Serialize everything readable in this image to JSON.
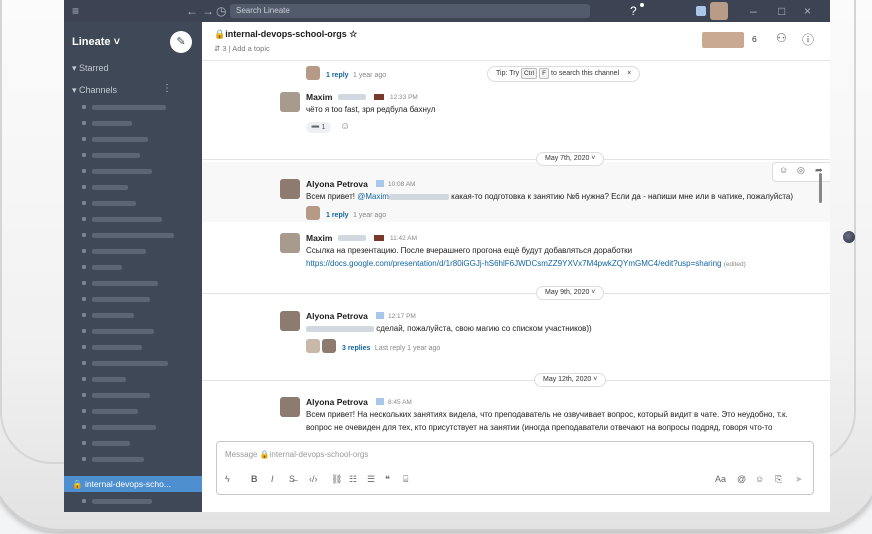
{
  "titlebar": {
    "search_placeholder": "Search Lineate"
  },
  "sidebar": {
    "workspace": "Lineate ˅",
    "compose_icon": "edit-icon",
    "starred_label": "▾  Starred",
    "channels_label": "▾  Channels",
    "active_channel": "🔒  internal-devops-scho..."
  },
  "channel": {
    "title": "🔒internal-devops-school-orgs ☆",
    "meta": "⇵ 3  |  Add a topic",
    "member_count": "6"
  },
  "tip": {
    "prefix": "Tip: Try",
    "key1": "Ctrl",
    "key2": "F",
    "suffix": "to search this channel",
    "close": "×"
  },
  "messages": {
    "m0": {
      "reply": "1 reply",
      "reply_meta": "1 year ago"
    },
    "m1": {
      "name": "Maxim",
      "time": "12:33 PM",
      "text": "чёто я too fast, зря редбула бахнул",
      "reaction": "➖ 1"
    },
    "d1": "May 7th, 2020 ˅",
    "m2": {
      "name": "Alyona Petrova",
      "time": "10:08 AM",
      "text_a": "Всем привет!",
      "mention": "@Maxim",
      "text_b": "какая-то подготовка к занятию №6 нужна? Если да - напиши мне или в чатике, пожалуйста)",
      "reply": "1 reply",
      "reply_meta": "1 year ago"
    },
    "m3": {
      "name": "Maxim",
      "time": "11:42 AM",
      "text": "Ссылка на презентацию. После вчерашнего прогона ещё будут добавляться доработки",
      "link": "https://docs.google.com/presentation/d/1r80iGGJj-hS6hlF6JWDCsmZZ9YXVx7M4pwkZQYmGMC4/edit?usp=sharing",
      "edited": "(edited)"
    },
    "d2": "May 9th, 2020 ˅",
    "m4": {
      "name": "Alyona Petrova",
      "time": "12:17 PM",
      "text": "сделай, пожалуйста, свою магию со списком участников))",
      "reply": "3 replies",
      "reply_meta": "Last reply 1 year ago"
    },
    "d3": "May 12th, 2020 ˅",
    "m5": {
      "name": "Alyona Petrova",
      "time": "8:45 AM",
      "line1": "Всем привет! На нескольких занятиях видела, что преподаватель не озвучивает вопрос, который видит в чате. Это неудобно, т.к.",
      "line2": "вопрос не очевиден для тех, кто присутствует на занятии (иногда преподаватели отвечают на вопросы подряд, говоря что-то"
    }
  },
  "composer": {
    "placeholder": "Message 🔒internal-devops-school-orgs",
    "aa": "Aa"
  },
  "colors": {
    "sidebar": "#3e4856",
    "titlebar": "#3c4453",
    "active": "#4e8fd0",
    "link": "#1264a3"
  }
}
